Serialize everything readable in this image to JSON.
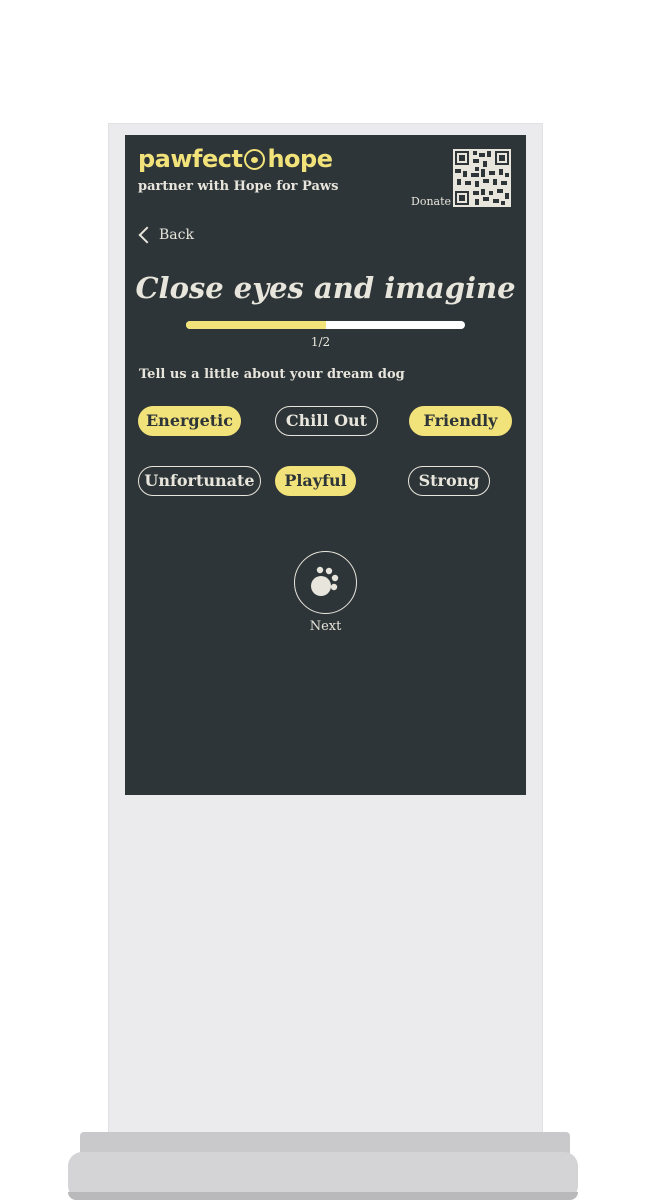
{
  "brand": {
    "logo_left": "pawfect",
    "logo_right": "hope",
    "tagline": "partner with Hope for Paws",
    "accent_color": "#f2e27a"
  },
  "donate": {
    "label": "Donate"
  },
  "nav": {
    "back_label": "Back"
  },
  "hero": {
    "title": "Close eyes and imagine"
  },
  "progress": {
    "text": "1/2",
    "fraction": 0.5
  },
  "question": {
    "prompt": "Tell us a little about your dream dog"
  },
  "traits": [
    {
      "label": "Energetic",
      "selected": true
    },
    {
      "label": "Chill Out",
      "selected": false
    },
    {
      "label": "Friendly",
      "selected": true
    },
    {
      "label": "Unfortunate",
      "selected": false
    },
    {
      "label": "Playful",
      "selected": true
    },
    {
      "label": "Strong",
      "selected": false
    }
  ],
  "next": {
    "label": "Next",
    "icon": "paw-icon"
  }
}
